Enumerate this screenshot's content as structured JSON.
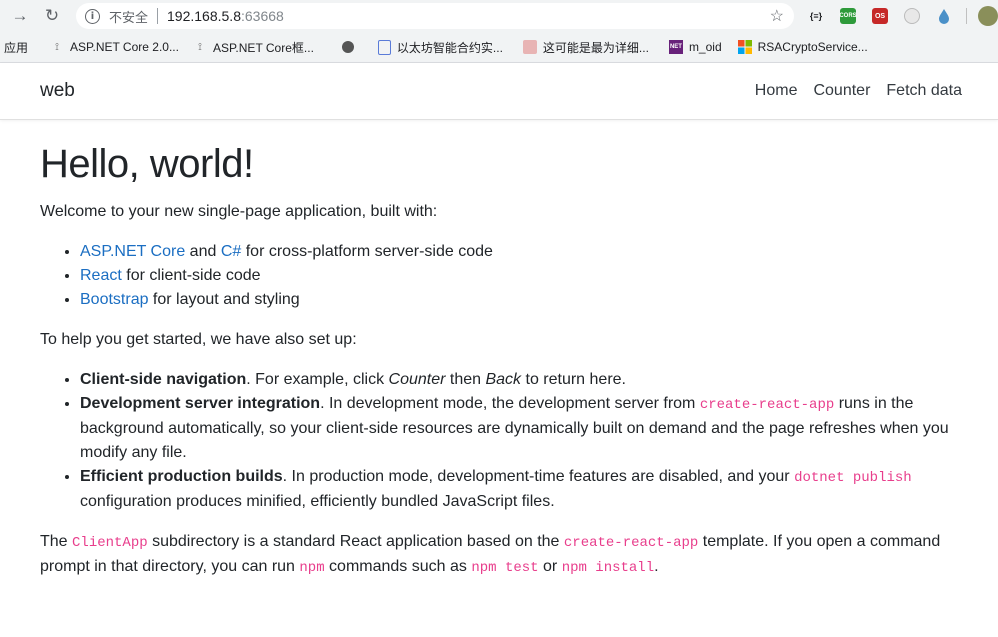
{
  "browser": {
    "insecure_label": "不安全",
    "url_host": "192.168.5.8",
    "url_port": ":63668",
    "bookmarks": [
      {
        "label": "应用"
      },
      {
        "label": "ASP.NET Core 2.0..."
      },
      {
        "label": "ASP.NET Core框..."
      },
      {
        "label": ""
      },
      {
        "label": "以太坊智能合约实..."
      },
      {
        "label": "这可能是最为详细..."
      },
      {
        "label": "m_oid"
      },
      {
        "label": "RSACryptoService..."
      }
    ],
    "extensions": {
      "json": "{≡}",
      "cors": "CORS",
      "red": "OS"
    }
  },
  "app": {
    "brand": "web",
    "nav": [
      "Home",
      "Counter",
      "Fetch data"
    ],
    "title": "Hello, world!",
    "welcome": "Welcome to your new single-page application, built with:",
    "built_with": [
      {
        "links": [
          "ASP.NET Core"
        ],
        "mid": " and ",
        "link2": "C#",
        "rest": " for cross-platform server-side code"
      },
      {
        "links": [
          "React"
        ],
        "rest": " for client-side code"
      },
      {
        "links": [
          "Bootstrap"
        ],
        "rest": " for layout and styling"
      }
    ],
    "help_intro": "To help you get started, we have also set up:",
    "features": [
      {
        "bold": "Client-side navigation",
        "t1": ". For example, click ",
        "i1": "Counter",
        "t2": " then ",
        "i2": "Back",
        "t3": " to return here."
      },
      {
        "bold": "Development server integration",
        "t1": ". In development mode, the development server from ",
        "code": "create-react-app",
        "t2": " runs in the background automatically, so your client-side resources are dynamically built on demand and the page refreshes when you modify any file."
      },
      {
        "bold": "Efficient production builds",
        "t1": ". In production mode, development-time features are disabled, and your ",
        "code": "dotnet publish",
        "t2": " configuration produces minified, efficiently bundled JavaScript files."
      }
    ],
    "final": {
      "t1": "The ",
      "c1": "ClientApp",
      "t2": " subdirectory is a standard React application based on the ",
      "c2": "create-react-app",
      "t3": " template. If you open a command prompt in that directory, you can run ",
      "c3": "npm",
      "t4": " commands such as ",
      "c4": "npm test",
      "t5": " or ",
      "c5": "npm install",
      "t6": "."
    }
  }
}
